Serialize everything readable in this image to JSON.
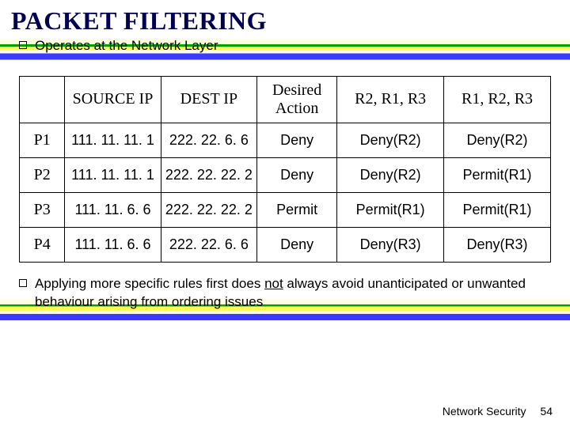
{
  "title": "PACKET FILTERING",
  "bullet1": "Operates at the Network Layer",
  "table": {
    "headers": [
      "",
      "SOURCE IP",
      "DEST IP",
      "Desired Action",
      "R2, R1, R3",
      "R1, R2, R3"
    ],
    "rows": [
      {
        "id": "P1",
        "src": "111. 11. 11. 1",
        "dst": "222. 22. 6. 6",
        "desired": "Deny",
        "order1": "Deny(R2)",
        "order2": "Deny(R2)"
      },
      {
        "id": "P2",
        "src": "111. 11. 11. 1",
        "dst": "222. 22. 22. 2",
        "desired": "Deny",
        "order1": "Deny(R2)",
        "order2": "Permit(R1)"
      },
      {
        "id": "P3",
        "src": "111. 11. 6. 6",
        "dst": "222. 22. 22. 2",
        "desired": "Permit",
        "order1": "Permit(R1)",
        "order2": "Permit(R1)"
      },
      {
        "id": "P4",
        "src": "111. 11. 6. 6",
        "dst": "222. 22. 6. 6",
        "desired": "Deny",
        "order1": "Deny(R3)",
        "order2": "Deny(R3)"
      }
    ]
  },
  "note_pre": "Applying more specific rules first does ",
  "note_underline": "not",
  "note_post": " always avoid unanticipated or unwanted behaviour arising from ordering issues",
  "footer_label": "Network Security",
  "page_number": "54"
}
